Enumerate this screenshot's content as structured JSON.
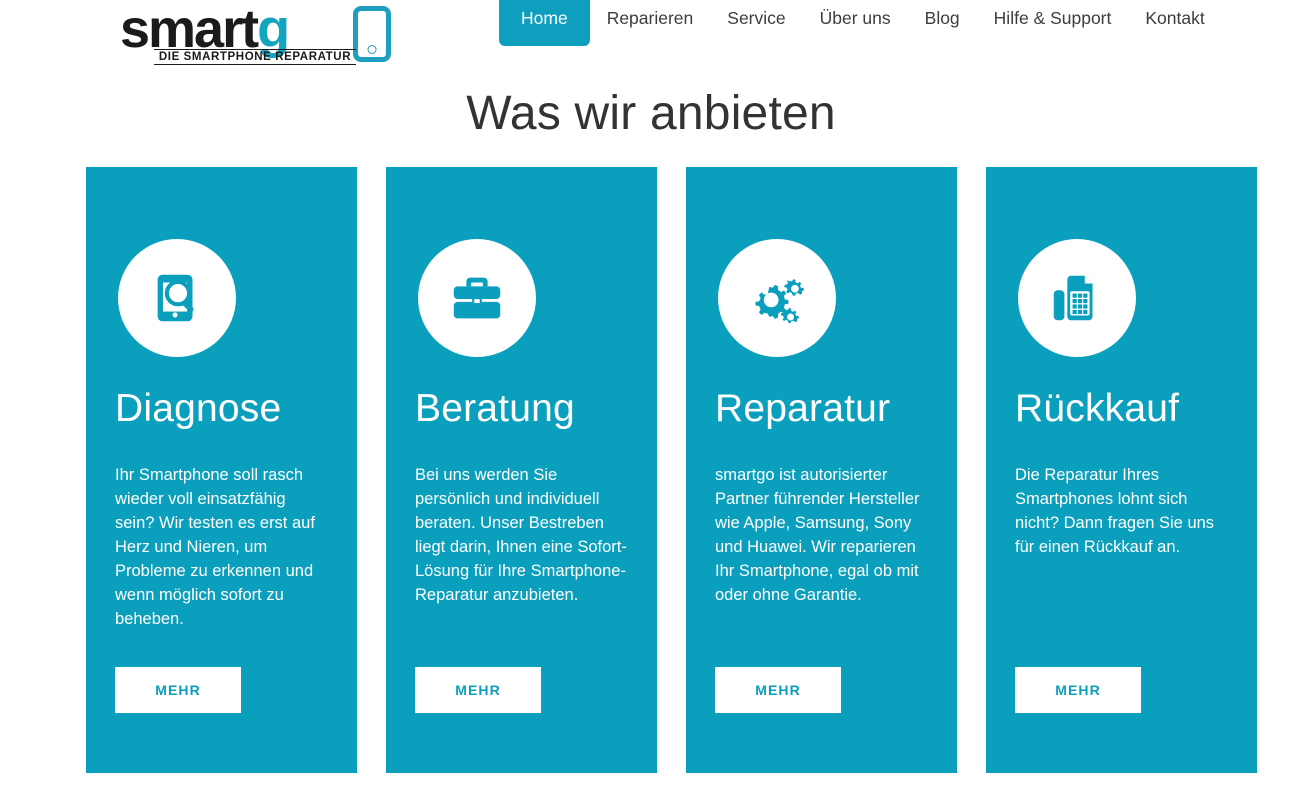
{
  "brand": {
    "name_part1": "smart",
    "name_part2": "g",
    "tagline": "DIE SMARTPHONE REPARATUR",
    "accent_color": "#0a9fbd",
    "logo_text_color": "#1b1b1b"
  },
  "nav": {
    "items": [
      {
        "label": "Home",
        "active": true
      },
      {
        "label": "Reparieren",
        "active": false
      },
      {
        "label": "Service",
        "active": false
      },
      {
        "label": "Über uns",
        "active": false
      },
      {
        "label": "Blog",
        "active": false
      },
      {
        "label": "Hilfe & Support",
        "active": false
      },
      {
        "label": "Kontakt",
        "active": false
      }
    ]
  },
  "main": {
    "heading": "Was wir anbieten",
    "cards": [
      {
        "icon": "smartphone-magnifier-icon",
        "title": "Diagnose",
        "body": "Ihr Smartphone soll rasch wieder voll einsatzfähig sein? Wir testen es erst auf Herz und Nieren, um Probleme zu erkennen und wenn möglich sofort zu beheben.",
        "button_label": "MEHR"
      },
      {
        "icon": "briefcase-icon",
        "title": "Beratung",
        "body": "Bei uns werden Sie persönlich und individuell beraten. Unser Bestreben liegt darin, Ihnen eine Sofort-Lösung für Ihre Smartphone-Reparatur anzubieten.",
        "button_label": "MEHR"
      },
      {
        "icon": "gears-icon",
        "title": "Reparatur",
        "body": "smartgo ist autorisierter Partner führender Hersteller wie Apple, Samsung, Sony und Huawei. Wir reparieren Ihr Smartphone, egal ob mit oder ohne Garantie.",
        "button_label": "MEHR"
      },
      {
        "icon": "cash-register-icon",
        "title": "Rückkauf",
        "body": "Die Reparatur Ihres Smartphones lohnt sich nicht? Dann fragen Sie uns für einen Rückkauf an.",
        "button_label": "MEHR"
      }
    ]
  }
}
